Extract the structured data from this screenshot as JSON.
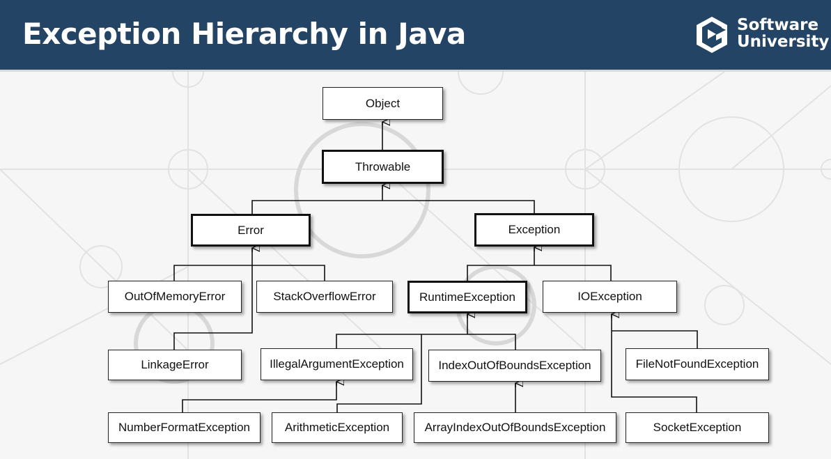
{
  "header": {
    "title": "Exception Hierarchy in Java",
    "logo_line1": "Software",
    "logo_line2": "University",
    "background": "#234465"
  },
  "diagram": {
    "nodes": {
      "object": "Object",
      "throwable": "Throwable",
      "error": "Error",
      "exception": "Exception",
      "out_of_memory_error": "OutOfMemoryError",
      "stack_overflow_error": "StackOverflowError",
      "runtime_exception": "RuntimeException",
      "io_exception": "IOException",
      "linkage_error": "LinkageError",
      "illegal_argument_exception": "IllegalArgumentException",
      "index_out_of_bounds_exception": "IndexOutOfBoundsException",
      "file_not_found_exception": "FileNotFoundException",
      "number_format_exception": "NumberFormatException",
      "arithmetic_exception": "ArithmeticException",
      "array_index_out_of_bounds_exception": "ArrayIndexOutOfBoundsException",
      "socket_exception": "SocketException"
    },
    "edges": [
      [
        "throwable",
        "object"
      ],
      [
        "error",
        "throwable"
      ],
      [
        "exception",
        "throwable"
      ],
      [
        "out_of_memory_error",
        "error"
      ],
      [
        "stack_overflow_error",
        "error"
      ],
      [
        "linkage_error",
        "error"
      ],
      [
        "runtime_exception",
        "exception"
      ],
      [
        "io_exception",
        "exception"
      ],
      [
        "illegal_argument_exception",
        "runtime_exception"
      ],
      [
        "index_out_of_bounds_exception",
        "runtime_exception"
      ],
      [
        "arithmetic_exception",
        "runtime_exception"
      ],
      [
        "file_not_found_exception",
        "io_exception"
      ],
      [
        "socket_exception",
        "io_exception"
      ],
      [
        "number_format_exception",
        "illegal_argument_exception"
      ],
      [
        "array_index_out_of_bounds_exception",
        "index_out_of_bounds_exception"
      ]
    ]
  }
}
